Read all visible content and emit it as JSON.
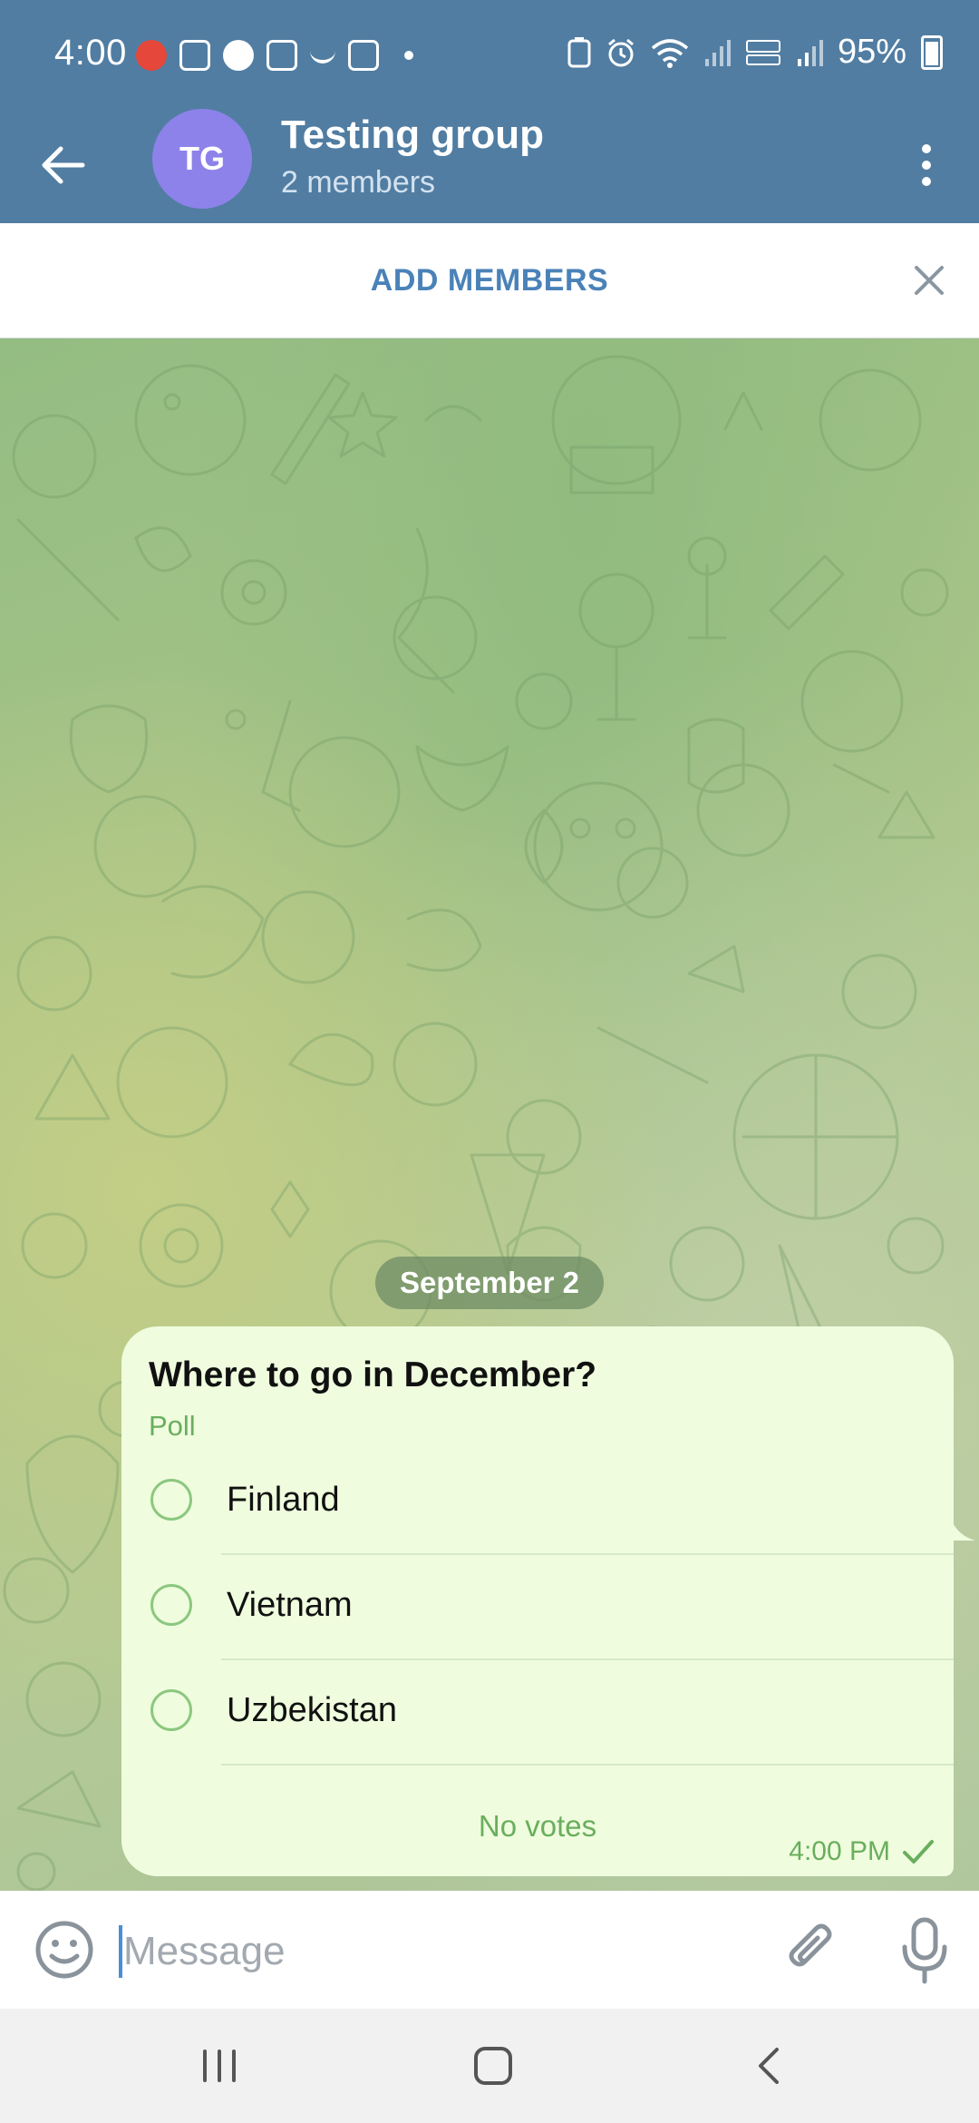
{
  "status_bar": {
    "time": "4:00",
    "battery": "95%"
  },
  "header": {
    "avatar_initials": "TG",
    "title": "Testing group",
    "subtitle": "2 members",
    "avatar_color": "#8d82ea",
    "bar_color": "#517da2"
  },
  "banner": {
    "add_members_label": "ADD MEMBERS"
  },
  "chat": {
    "date_label": "September 2",
    "poll": {
      "question": "Where to go in December?",
      "type_label": "Poll",
      "options": [
        {
          "label": "Finland"
        },
        {
          "label": "Vietnam"
        },
        {
          "label": "Uzbekistan"
        }
      ],
      "votes_label": "No votes",
      "time": "4:00 PM",
      "status_icon": "single-check-icon"
    }
  },
  "composer": {
    "placeholder": "Message",
    "value": ""
  },
  "icons": {
    "back": "arrow-left-icon",
    "more": "more-vertical-icon",
    "close": "close-icon",
    "emoji": "emoji-icon",
    "attach": "paperclip-icon",
    "mic": "microphone-icon",
    "nav_recents": "recents-icon",
    "nav_home": "home-icon",
    "nav_back": "nav-back-icon"
  }
}
